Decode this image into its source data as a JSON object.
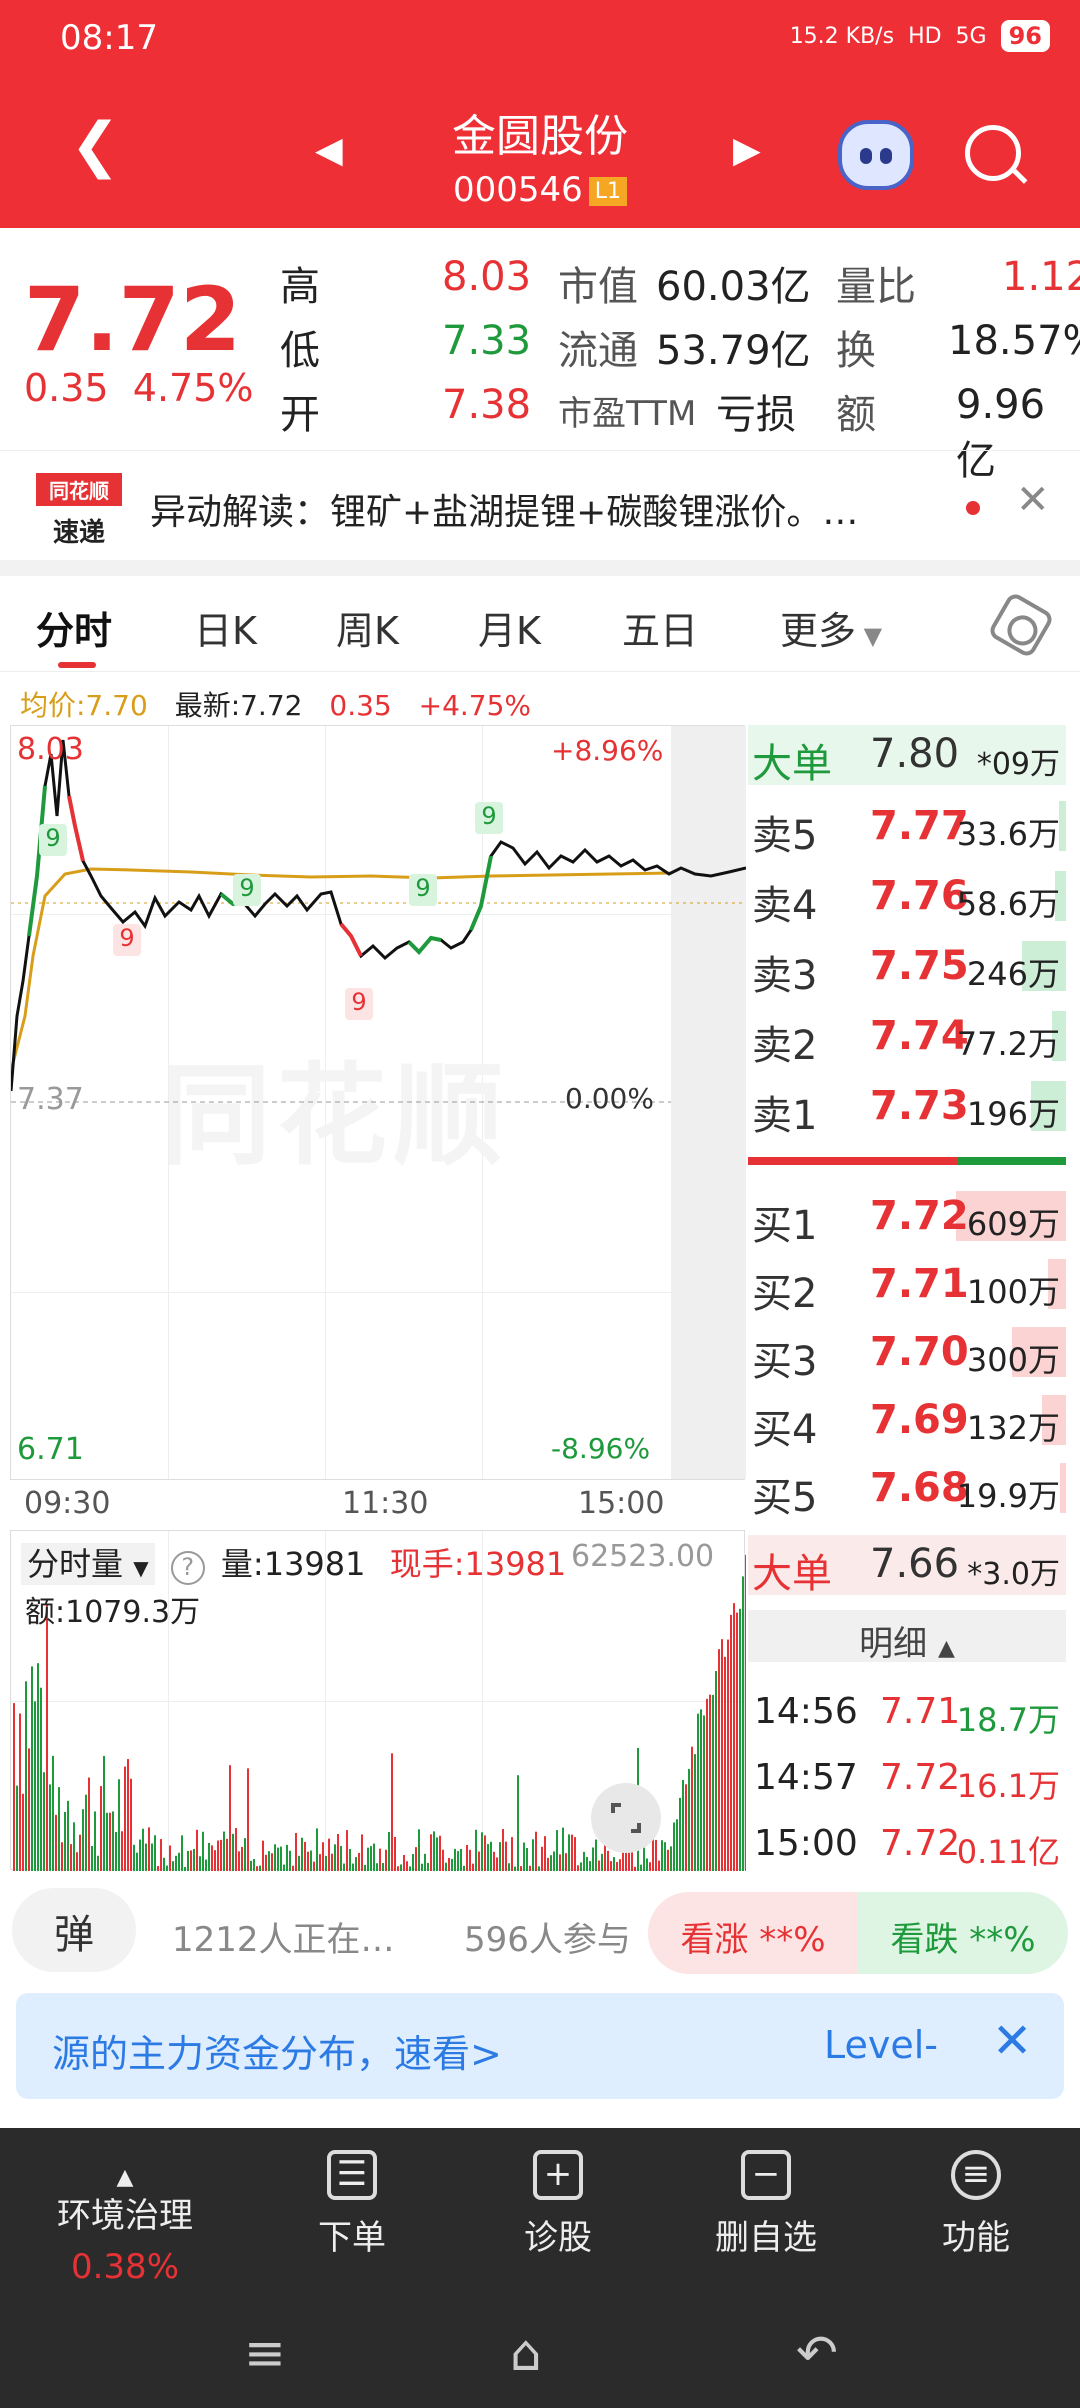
{
  "status": {
    "time": "08:17",
    "net_speed": "15.2 KB/s",
    "hd": "HD",
    "signal": "5G",
    "battery": "96"
  },
  "header": {
    "name": "金圆股份",
    "code": "000546",
    "level": "L1"
  },
  "quote": {
    "price": "7.72",
    "change": "0.35",
    "change_pct": "4.75%",
    "high_label": "高",
    "high": "8.03",
    "low_label": "低",
    "low": "7.33",
    "open_label": "开",
    "open": "7.38",
    "mktcap_label": "市值",
    "mktcap": "60.03亿",
    "float_label": "流通",
    "float": "53.79亿",
    "pe_label": "市盈TTM",
    "pe": "亏损",
    "ratio_label": "量比",
    "ratio": "1.12",
    "turnover_label": "换",
    "turnover": "18.57%",
    "amount_label": "额",
    "amount": "9.96亿"
  },
  "news": {
    "logo_top": "同花顺",
    "logo_bottom": "速递",
    "text": "异动解读：锂矿+盐湖提锂+碳酸锂涨价。…"
  },
  "tabs": [
    "分时",
    "日K",
    "周K",
    "月K",
    "五日",
    "更多"
  ],
  "chart_info": {
    "avg": "均价:7.70",
    "latest": "最新:7.72",
    "chg": "0.35",
    "pct": "+4.75%"
  },
  "chart": {
    "top_price": "8.03",
    "top_pct": "+8.96%",
    "mid_price": "7.37",
    "mid_pct": "0.00%",
    "bot_price": "6.71",
    "bot_pct": "-8.96%",
    "watermark": "同花顺",
    "times": [
      "09:30",
      "11:30",
      "15:00"
    ],
    "marker": "9"
  },
  "book": {
    "big1": {
      "label": "大单",
      "price": "7.80",
      "vol": "*09万"
    },
    "asks": [
      {
        "label": "卖5",
        "price": "7.77",
        "vol": "33.6万",
        "level": 0.06
      },
      {
        "label": "卖4",
        "price": "7.76",
        "vol": "58.6万",
        "level": 0.1
      },
      {
        "label": "卖3",
        "price": "7.75",
        "vol": "246万",
        "level": 0.4
      },
      {
        "label": "卖2",
        "price": "7.74",
        "vol": "77.2万",
        "level": 0.13
      },
      {
        "label": "卖1",
        "price": "7.73",
        "vol": "196万",
        "level": 0.32
      }
    ],
    "bids": [
      {
        "label": "买1",
        "price": "7.72",
        "vol": "609万",
        "level": 1.0
      },
      {
        "label": "买2",
        "price": "7.71",
        "vol": "100万",
        "level": 0.16
      },
      {
        "label": "买3",
        "price": "7.70",
        "vol": "300万",
        "level": 0.49
      },
      {
        "label": "买4",
        "price": "7.69",
        "vol": "132万",
        "level": 0.22
      },
      {
        "label": "买5",
        "price": "7.68",
        "vol": "19.9万",
        "level": 0.03
      }
    ],
    "big2": {
      "label": "大单",
      "price": "7.66",
      "vol": "*3.0万"
    },
    "detail_label": "明细",
    "trades": [
      {
        "time": "14:56",
        "price": "7.71",
        "vol": "18.7万"
      },
      {
        "time": "14:57",
        "price": "7.72",
        "vol": "16.1万"
      },
      {
        "time": "15:00",
        "price": "7.72",
        "vol": "0.11亿"
      }
    ]
  },
  "volume": {
    "mode": "分时量",
    "vol": "量:13981",
    "now": "现手:13981",
    "amount": "额:1079.3万",
    "max": "62523.00"
  },
  "social": {
    "danmu": "弹",
    "watching": "1212人正在…",
    "participants": "596人参与",
    "up": "看涨 **%",
    "down": "看跌 **%"
  },
  "promo": {
    "text": "源的主力资金分布，速看>",
    "level": "Level-"
  },
  "nav": {
    "sector": "环境治理",
    "sector_pct": "0.38%",
    "items": [
      "下单",
      "诊股",
      "删自选",
      "功能"
    ]
  },
  "colors": {
    "red": "#e63234",
    "green": "#1e9a3c",
    "gold": "#d89e1a",
    "header_bg": "#ee2f36"
  }
}
